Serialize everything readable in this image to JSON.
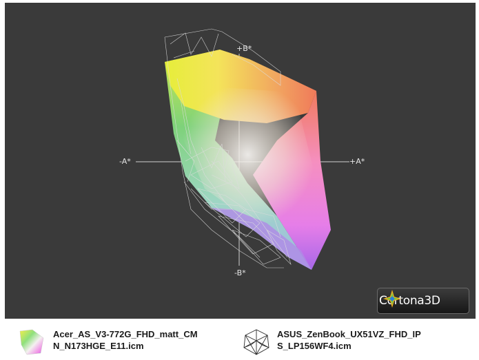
{
  "viewer": {
    "axis_labels": {
      "b_plus": "+B*",
      "b_minus": "-B*",
      "a_minus": "-A*",
      "a_plus": "+A*"
    },
    "logo_text": "Cortona3D"
  },
  "legend": [
    {
      "icon": "color-solid-gamut-icon",
      "text": "Acer_AS_V3-772G_FHD_matt_CMN_N173HGE_E11.icm"
    },
    {
      "icon": "wireframe-gamut-icon",
      "text": "ASUS_ZenBook_UX51VZ_FHD_IPS_LP156WF4.icm"
    }
  ],
  "colors": {
    "viewport_bg": "#3a3a3a",
    "axis": "#d0d0d0",
    "wire": "#d9d9d9"
  }
}
